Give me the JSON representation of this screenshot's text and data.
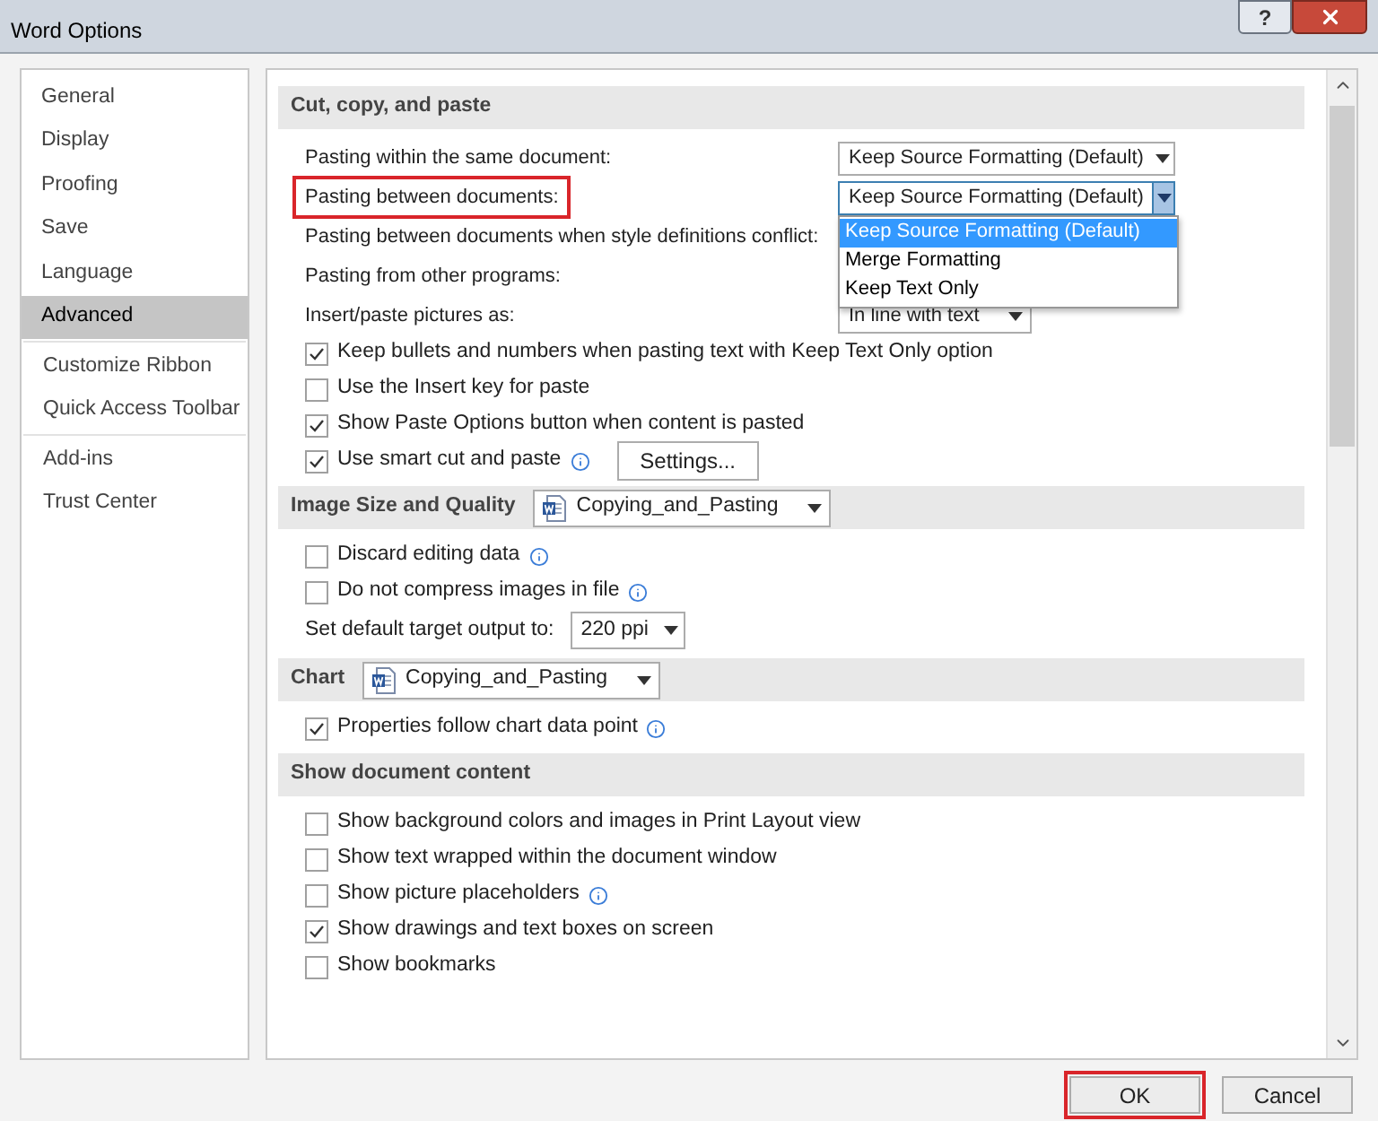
{
  "window": {
    "title": "Word Options",
    "help": "?"
  },
  "sidebar": {
    "groups": [
      [
        {
          "label": "General",
          "selected": false
        },
        {
          "label": "Display",
          "selected": false
        },
        {
          "label": "Proofing",
          "selected": false
        },
        {
          "label": "Save",
          "selected": false
        },
        {
          "label": "Language",
          "selected": false
        },
        {
          "label": "Advanced",
          "selected": true
        }
      ],
      [
        {
          "label": "Customize Ribbon",
          "selected": false
        },
        {
          "label": "Quick Access Toolbar",
          "selected": false
        }
      ],
      [
        {
          "label": "Add-ins",
          "selected": false
        },
        {
          "label": "Trust Center",
          "selected": false
        }
      ]
    ]
  },
  "sections": [
    {
      "title": "Cut, copy, and paste",
      "rows": [
        {
          "kind": "select",
          "label": "Pasting within the same document:",
          "value": "Keep Source Formatting (Default)",
          "open": false,
          "highlighted": false
        },
        {
          "kind": "select",
          "label": "Pasting between documents:",
          "value": "Keep Source Formatting (Default)",
          "open": true,
          "highlighted": true,
          "menu": [
            {
              "label": "Keep Source Formatting (Default)",
              "selected": true
            },
            {
              "label": "Merge Formatting",
              "selected": false
            },
            {
              "label": "Keep Text Only",
              "selected": false
            }
          ]
        },
        {
          "kind": "select",
          "label": "Pasting between documents when style definitions conflict:",
          "highlighted": false
        },
        {
          "kind": "select",
          "label": "Pasting from other programs:",
          "highlighted": false
        },
        {
          "kind": "short_select",
          "label": "Insert/paste pictures as:",
          "value": "In line with text",
          "open": false,
          "highlighted": false
        },
        {
          "kind": "checkbox",
          "label": "Keep bullets and numbers when pasting text with Keep Text Only option",
          "checked": true,
          "info": false
        },
        {
          "kind": "checkbox",
          "label": "Use the Insert key for paste",
          "checked": false,
          "info": false
        },
        {
          "kind": "checkbox",
          "label": "Show Paste Options button when content is pasted",
          "checked": true,
          "info": false
        },
        {
          "kind": "checkbox",
          "label": "Use smart cut and paste",
          "checked": true,
          "info": true,
          "button": "Settings..."
        }
      ]
    },
    {
      "title": "Image Size and Quality",
      "document": "Copying_and_Pasting",
      "rows": [
        {
          "kind": "checkbox",
          "label": "Discard editing data",
          "checked": false,
          "info": true
        },
        {
          "kind": "checkbox",
          "label": "Do not compress images in file",
          "checked": false,
          "info": true
        },
        {
          "kind": "inline_select",
          "label": "Set default target output to:",
          "value": "220 ppi"
        }
      ]
    },
    {
      "title": "Chart",
      "document": "Copying_and_Pasting",
      "rows": [
        {
          "kind": "checkbox",
          "label": "Properties follow chart data point",
          "checked": true,
          "info": true
        }
      ]
    },
    {
      "title": "Show document content",
      "rows": [
        {
          "kind": "checkbox",
          "label": "Show background colors and images in Print Layout view",
          "checked": false,
          "info": false
        },
        {
          "kind": "checkbox",
          "label": "Show text wrapped within the document window",
          "checked": false,
          "info": false
        },
        {
          "kind": "checkbox",
          "label": "Show picture placeholders",
          "checked": false,
          "info": true
        },
        {
          "kind": "checkbox",
          "label": "Show drawings and text boxes on screen",
          "checked": true,
          "info": false
        },
        {
          "kind": "checkbox",
          "label": "Show bookmarks",
          "checked": false,
          "info": false
        }
      ]
    }
  ],
  "buttons": [
    {
      "label": "OK",
      "highlighted": true
    },
    {
      "label": "Cancel",
      "highlighted": false
    }
  ]
}
